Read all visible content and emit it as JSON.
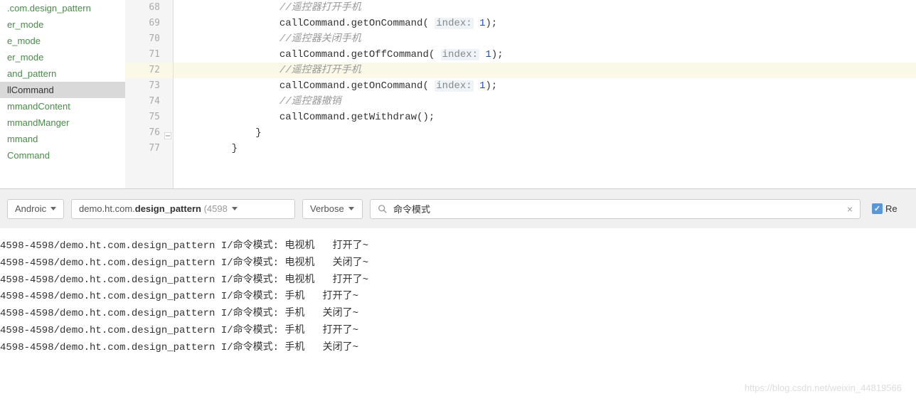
{
  "sidebar": {
    "items": [
      ".com.design_pattern",
      "er_mode",
      "e_mode",
      "er_mode",
      "and_pattern",
      "llCommand",
      "mmandContent",
      "mmandManger",
      "mmand",
      "Command"
    ],
    "selectedIndex": 5
  },
  "editor": {
    "lines": [
      {
        "num": "68",
        "type": "comment",
        "indent": 3,
        "text": "//遥控器打开手机"
      },
      {
        "num": "69",
        "type": "callhint",
        "indent": 3,
        "text": "callCommand.getOnCommand(",
        "hint": "index:",
        "val": "1",
        "tail": ");"
      },
      {
        "num": "70",
        "type": "comment",
        "indent": 3,
        "text": "//遥控器关闭手机"
      },
      {
        "num": "71",
        "type": "callhint",
        "indent": 3,
        "text": "callCommand.getOffCommand(",
        "hint": "index:",
        "val": "1",
        "tail": ");"
      },
      {
        "num": "72",
        "type": "comment",
        "indent": 3,
        "text": "//遥控器打开手机",
        "highlight": true
      },
      {
        "num": "73",
        "type": "callhint",
        "indent": 3,
        "text": "callCommand.getOnCommand(",
        "hint": "index:",
        "val": "1",
        "tail": ");"
      },
      {
        "num": "74",
        "type": "comment",
        "indent": 3,
        "text": "//遥控器撤销"
      },
      {
        "num": "75",
        "type": "code",
        "indent": 3,
        "text": "callCommand.getWithdraw();"
      },
      {
        "num": "76",
        "type": "code",
        "indent": 2,
        "text": "}",
        "fold": true
      },
      {
        "num": "77",
        "type": "code",
        "indent": 1,
        "text": "}"
      },
      {
        "num": "",
        "type": "empty"
      }
    ]
  },
  "toolbar": {
    "device": "Androic",
    "process_prefix": "demo.ht.com.",
    "process_bold": "design_pattern",
    "process_suffix": " (4598",
    "loglevel": "Verbose",
    "search_value": "命令模式",
    "checkbox_label": "Re"
  },
  "logs": [
    "4598-4598/demo.ht.com.design_pattern I/命令模式: 电视机   打开了~",
    "4598-4598/demo.ht.com.design_pattern I/命令模式: 电视机   关闭了~",
    "4598-4598/demo.ht.com.design_pattern I/命令模式: 电视机   打开了~",
    "4598-4598/demo.ht.com.design_pattern I/命令模式: 手机   打开了~",
    "4598-4598/demo.ht.com.design_pattern I/命令模式: 手机   关闭了~",
    "4598-4598/demo.ht.com.design_pattern I/命令模式: 手机   打开了~",
    "4598-4598/demo.ht.com.design_pattern I/命令模式: 手机   关闭了~"
  ],
  "watermark": "https://blog.csdn.net/weixin_44819566"
}
